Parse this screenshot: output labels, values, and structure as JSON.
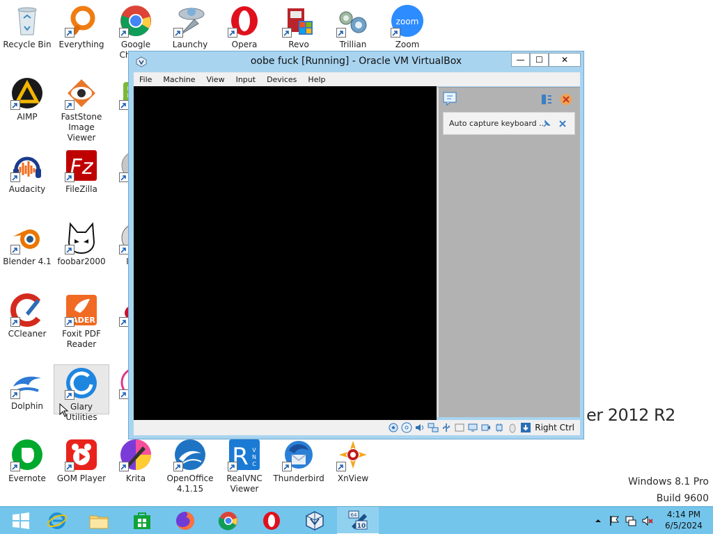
{
  "desktop": {
    "icons": [
      {
        "label": "Recycle Bin",
        "icon": "recycle-bin-icon"
      },
      {
        "label": "Everything",
        "icon": "everything-icon"
      },
      {
        "label": "Google Chrome",
        "icon": "chrome-icon"
      },
      {
        "label": "Launchy",
        "icon": "launchy-icon"
      },
      {
        "label": "Opera",
        "icon": "opera-icon"
      },
      {
        "label": "Revo",
        "icon": "revo-icon"
      },
      {
        "label": "Trillian",
        "icon": "trillian-icon"
      },
      {
        "label": "Zoom",
        "icon": "zoom-icon"
      },
      {
        "label": "AIMP",
        "icon": "aimp-icon"
      },
      {
        "label": "FastStone Image Viewer",
        "icon": "faststone-icon"
      },
      {
        "label": "Gre",
        "icon": "greenshot-icon"
      },
      {
        "label": "Audacity",
        "icon": "audacity-icon"
      },
      {
        "label": "FileZilla",
        "icon": "filezilla-icon"
      },
      {
        "label": "Im",
        "icon": "imgburn-icon"
      },
      {
        "label": "Blender 4.1",
        "icon": "blender-icon"
      },
      {
        "label": "foobar2000",
        "icon": "foobar2000-icon"
      },
      {
        "label": "Infra",
        "icon": "infrarecorder-icon"
      },
      {
        "label": "CCleaner",
        "icon": "ccleaner-icon"
      },
      {
        "label": "Foxit PDF Reader",
        "icon": "foxit-reader-icon"
      },
      {
        "label": "Irfa",
        "icon": "irfanview-icon"
      },
      {
        "label": "Dolphin",
        "icon": "dolphin-icon"
      },
      {
        "label": "Glary Utilities",
        "icon": "glary-utilities-icon"
      },
      {
        "label": "iT",
        "icon": "itunes-icon"
      },
      {
        "label": "Evernote",
        "icon": "evernote-icon"
      },
      {
        "label": "GOM Player",
        "icon": "gom-player-icon"
      },
      {
        "label": "Krita",
        "icon": "krita-icon"
      },
      {
        "label": "OpenOffice 4.1.15",
        "icon": "openoffice-icon"
      },
      {
        "label": "RealVNC Viewer",
        "icon": "realvnc-icon"
      },
      {
        "label": "Thunderbird",
        "icon": "thunderbird-icon"
      },
      {
        "label": "XnView",
        "icon": "xnview-icon"
      }
    ],
    "selected_icon": "Glary Utilities",
    "branding": {
      "server_edition": "er 2012 R2",
      "os_line": "Windows 8.1 Pro",
      "build_line": "Build 9600"
    }
  },
  "vbox_window": {
    "title": "oobe fuck [Running] - Oracle VM VirtualBox",
    "buttons": {
      "minimize": "—",
      "maximize": "☐",
      "close": "✕"
    },
    "menu": [
      "File",
      "Machine",
      "View",
      "Input",
      "Devices",
      "Help"
    ],
    "notification": {
      "text": "Auto capture keyboard ..."
    },
    "status_bar": {
      "icons": [
        "hard-disk-icon",
        "optical-drive-icon",
        "audio-icon",
        "network-icon",
        "usb-icon",
        "shared-folder-icon",
        "display-icon",
        "video-capture-icon",
        "cpu-icon",
        "mouse-integration-icon",
        "keyboard-capture-icon"
      ],
      "host_key": "Right Ctrl"
    }
  },
  "taskbar": {
    "items": [
      {
        "name": "start-button",
        "icon": "windows-logo-icon"
      },
      {
        "name": "internet-explorer",
        "icon": "ie-icon"
      },
      {
        "name": "file-explorer",
        "icon": "folder-icon"
      },
      {
        "name": "store",
        "icon": "store-icon"
      },
      {
        "name": "firefox",
        "icon": "firefox-icon"
      },
      {
        "name": "chrome",
        "icon": "chrome-icon"
      },
      {
        "name": "opera",
        "icon": "opera-icon"
      },
      {
        "name": "virtualbox",
        "icon": "virtualbox-icon"
      },
      {
        "name": "windows-10-vm",
        "icon": "vm-windows-10-icon"
      }
    ],
    "tray": [
      "show-hidden-icons-icon",
      "action-center-flag-icon",
      "network-icon",
      "volume-muted-icon"
    ],
    "clock": {
      "time": "4:14 PM",
      "date": "6/5/2024"
    }
  }
}
